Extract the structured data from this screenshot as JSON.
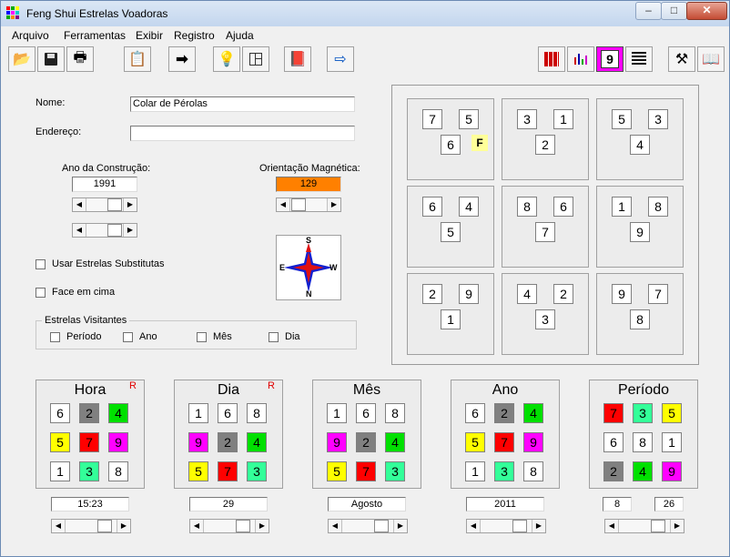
{
  "window": {
    "title": "Feng Shui Estrelas Voadoras",
    "controls": {
      "minimize": "–",
      "maximize": "□",
      "close": "✕"
    }
  },
  "menu": [
    "Arquivo",
    "Ferramentas",
    "Exibir",
    "Registro",
    "Ajuda"
  ],
  "toolbar": {
    "left_icons": [
      "open-folder-icon",
      "save-icon",
      "print-icon",
      "properties-icon",
      "arrow-right-icon",
      "lightbulb-icon",
      "floorplan-icon",
      "book-red-icon",
      "export-icon"
    ],
    "right_icons": [
      "grid-chart-icon",
      "bar-chart-icon",
      "number-nine-icon",
      "lines-icon",
      "tools-icon",
      "book-icon"
    ],
    "nine_label": "9"
  },
  "form": {
    "name_label": "Nome:",
    "name_value": "Colar de Pérolas",
    "address_label": "Endereço:",
    "address_value": "",
    "year_label": "Ano da Construção:",
    "year_value": "1991",
    "orientation_label": "Orientação Magnética:",
    "orientation_value": "129",
    "orientation_color": "#ff8000",
    "compass": {
      "n": "N",
      "s": "S",
      "e": "E",
      "w": "W"
    },
    "substitute_label": "Usar Estrelas Substitutas",
    "face_up_label": "Face em cima",
    "visitors_label": "Estrelas Visitantes",
    "visitors": [
      "Período",
      "Ano",
      "Mês",
      "Dia"
    ]
  },
  "grid": [
    {
      "a": "7",
      "b": "5",
      "c": "6",
      "f": "F"
    },
    {
      "a": "3",
      "b": "1",
      "c": "2"
    },
    {
      "a": "5",
      "b": "3",
      "c": "4"
    },
    {
      "a": "6",
      "b": "4",
      "c": "5"
    },
    {
      "a": "8",
      "b": "6",
      "c": "7"
    },
    {
      "a": "1",
      "b": "8",
      "c": "9"
    },
    {
      "a": "2",
      "b": "9",
      "c": "1"
    },
    {
      "a": "4",
      "b": "2",
      "c": "3"
    },
    {
      "a": "9",
      "b": "7",
      "c": "8"
    }
  ],
  "colors": {
    "1": "#ffffff",
    "2": "#808080",
    "3": "#33ff99",
    "4": "#00e000",
    "5": "#ffff00",
    "6": "#ffffff",
    "7": "#ff0000",
    "8": "#ffffff",
    "9": "#ff00ff",
    "f_marker": "#ffff99"
  },
  "time_boxes": [
    {
      "title": "Hora",
      "mark": "R",
      "numbers": [
        "6",
        "2",
        "4",
        "5",
        "7",
        "9",
        "1",
        "3",
        "8"
      ],
      "value": "15:23"
    },
    {
      "title": "Dia",
      "mark": "R",
      "numbers": [
        "1",
        "6",
        "8",
        "9",
        "2",
        "4",
        "5",
        "7",
        "3"
      ],
      "value": "29"
    },
    {
      "title": "Mês",
      "mark": "",
      "numbers": [
        "1",
        "6",
        "8",
        "9",
        "2",
        "4",
        "5",
        "7",
        "3"
      ],
      "value": "Agosto"
    },
    {
      "title": "Ano",
      "mark": "",
      "numbers": [
        "6",
        "2",
        "4",
        "5",
        "7",
        "9",
        "1",
        "3",
        "8"
      ],
      "value": "2011"
    },
    {
      "title": "Período",
      "mark": "",
      "numbers": [
        "7",
        "3",
        "5",
        "6",
        "8",
        "1",
        "2",
        "4",
        "9"
      ],
      "value_a": "8",
      "value_b": "26"
    }
  ]
}
